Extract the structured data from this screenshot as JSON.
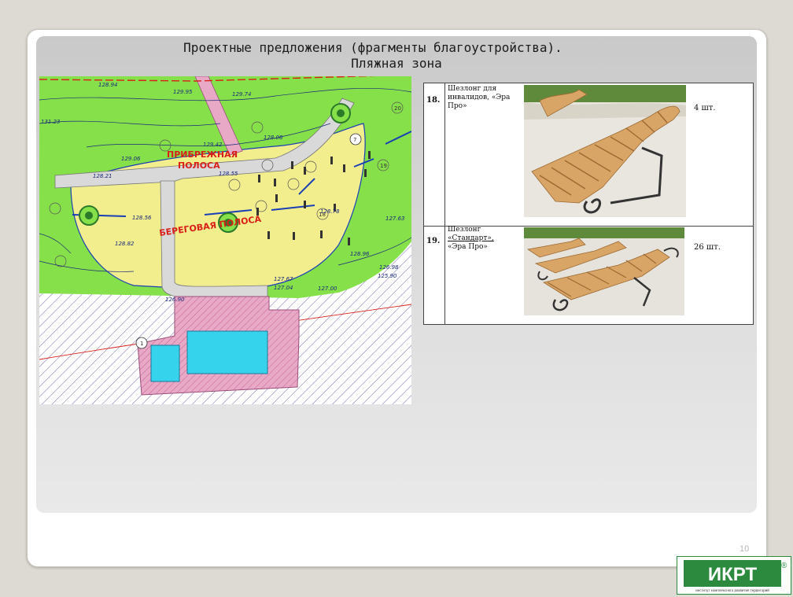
{
  "slide": {
    "title_line1": "Проектные предложения (фрагменты благоустройства).",
    "title_line2": "Пляжная зона",
    "page_number": "10"
  },
  "plan": {
    "zone_label_1a": "ПРИБРЕЖНАЯ",
    "zone_label_1b": "ПОЛОСА",
    "zone_label_2": "БЕРЕГОВАЯ ПОЛОСА",
    "markers": [
      "7",
      "1",
      "20",
      "19",
      "18"
    ],
    "elevations": [
      "128.94",
      "129.74",
      "129.42",
      "129.06",
      "128.08",
      "129.95",
      "128.21",
      "128.55",
      "128.56",
      "128.82",
      "128.78",
      "128.96",
      "127.63",
      "127.67",
      "127.04",
      "127.00",
      "126.98",
      "126.90",
      "125.90",
      "131.23"
    ]
  },
  "table": {
    "rows": [
      {
        "num": "18.",
        "name_line1": "Шезлонг для",
        "name_line2": "инвалидов, «Эра",
        "name_line3": "Про»",
        "qty": "4 шт."
      },
      {
        "num": "19.",
        "name_line1": "Шезлонг",
        "name_line2": "«Стандарт»,",
        "name_line3": "«Эра Про»",
        "qty": "26 шт."
      }
    ]
  },
  "logo": {
    "text": "ИКРТ",
    "registered": "®",
    "tagline": "институт комплексного развития территорий"
  },
  "colors": {
    "lawn_green": "#86e04a",
    "beach_yellow": "#f2ee8e",
    "path_gray": "#d9d9d9",
    "pool_cyan": "#35d3ec",
    "deck_pink": "#e8a9c6",
    "hatch_purple": "#7a6aa8",
    "logo_green": "#2c8a3e"
  }
}
